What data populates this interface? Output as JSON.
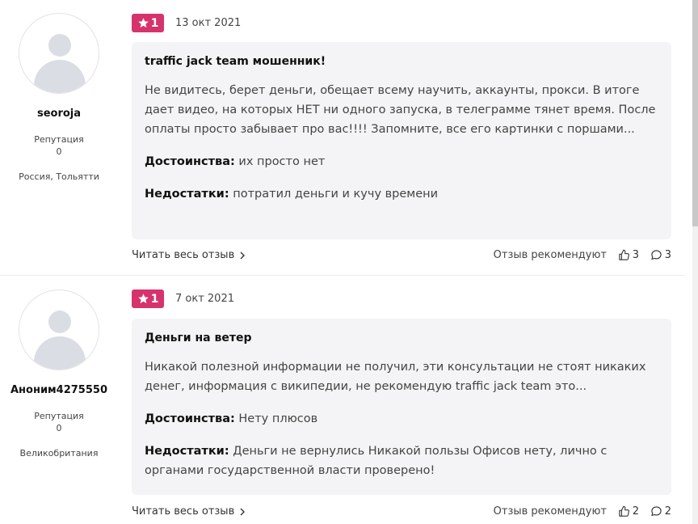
{
  "reviews": [
    {
      "author": {
        "nick": "seoroja",
        "rep_label": "Репутация",
        "rep_value": "0",
        "location": "Россия, Тольятти"
      },
      "rating": "1",
      "date": "13 окт 2021",
      "title": "traffic jack team мошенник!",
      "body": "Не видитесь, берет деньги, обещает всему научить, аккаунты, прокси. В итоге дает видео, на которых НЕТ ни одного запуска, в телеграмме тянет время. После оплаты просто забывает про вас!!!! Запомните, все его картинки с поршами...",
      "pros_label": "Достоинства:",
      "pros": "их просто нет",
      "cons_label": "Недостатки:",
      "cons": "потратил деньги и кучу времени",
      "read_more": "Читать весь отзыв",
      "recommend": "Отзыв рекомендуют",
      "likes": "3",
      "comments": "3"
    },
    {
      "author": {
        "nick": "Аноним4275550",
        "rep_label": "Репутация",
        "rep_value": "0",
        "location": "Великобритания"
      },
      "rating": "1",
      "date": "7 окт 2021",
      "title": "Деньги на ветер",
      "body": "Никакой полезной информации не получил, эти консультации не стоят никаких денег, информация с википедии, не рекомендую traffic jack team это...",
      "pros_label": "Достоинства:",
      "pros": "Нету плюсов",
      "cons_label": "Недостатки:",
      "cons": "Деньги не вернулись Никакой пользы Офисов нету, лично с органами государственной власти проверено!",
      "read_more": "Читать весь отзыв",
      "recommend": "Отзыв рекомендуют",
      "likes": "2",
      "comments": "2"
    }
  ],
  "colors": {
    "badge": "#d6336c",
    "card_bg": "#f4f4f6"
  },
  "icons": {
    "rating": "star-icon",
    "read_more": "chevron-right-icon",
    "likes": "thumbs-up-icon",
    "comments": "comment-icon"
  }
}
